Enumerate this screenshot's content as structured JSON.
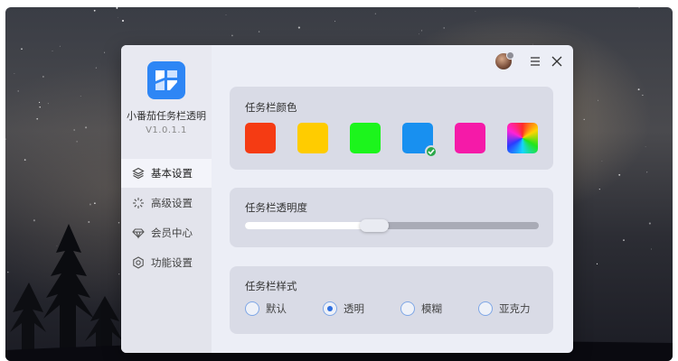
{
  "app": {
    "name": "小番茄任务栏透明",
    "version": "V1.0.1.1"
  },
  "sidebar": {
    "items": [
      {
        "label": "基本设置",
        "icon": "layers-icon",
        "active": true
      },
      {
        "label": "高级设置",
        "icon": "sparkle-icon",
        "active": false
      },
      {
        "label": "会员中心",
        "icon": "diamond-icon",
        "active": false
      },
      {
        "label": "功能设置",
        "icon": "gear-icon",
        "active": false
      }
    ]
  },
  "header": {
    "icons": [
      "avatar",
      "menu-icon",
      "close-icon"
    ]
  },
  "color_section": {
    "title": "任务栏颜色",
    "swatches": [
      {
        "name": "red",
        "color": "#f53b13"
      },
      {
        "name": "yellow",
        "color": "#ffcc00"
      },
      {
        "name": "green",
        "color": "#1cf51c"
      },
      {
        "name": "blue",
        "color": "#1890f0",
        "selected": true
      },
      {
        "name": "pink",
        "color": "#f51aa8"
      },
      {
        "name": "rainbow",
        "color": "conic"
      }
    ]
  },
  "opacity_section": {
    "title": "任务栏透明度",
    "value": 0.44
  },
  "style_section": {
    "title": "任务栏样式",
    "options": [
      {
        "label": "默认",
        "selected": false
      },
      {
        "label": "透明",
        "selected": true
      },
      {
        "label": "模糊",
        "selected": false
      },
      {
        "label": "亚克力",
        "selected": false
      }
    ]
  },
  "colors": {
    "accent": "#2e86f5",
    "check": "#2ba84a",
    "radio": "#2e6fe0"
  }
}
